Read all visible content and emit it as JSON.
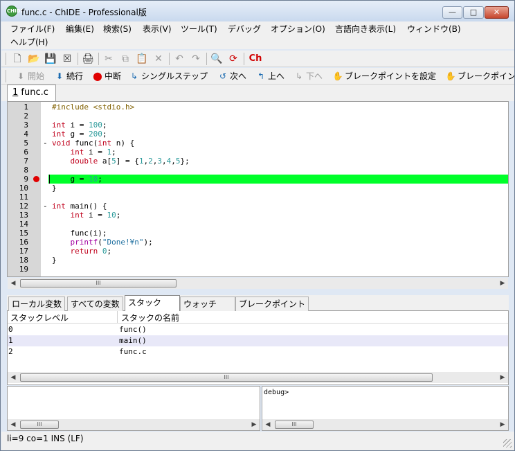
{
  "window": {
    "title": "func.c - ChIDE - Professional版",
    "icon_text": "CHIDE"
  },
  "menu": [
    "ファイル(F)",
    "編集(E)",
    "検索(S)",
    "表示(V)",
    "ツール(T)",
    "デバッグ",
    "オプション(O)",
    "言語向き表示(L)",
    "ウィンドウ(B)",
    "ヘルプ(H)"
  ],
  "toolbar": {
    "icons": [
      "new-file-icon",
      "open-folder-icon",
      "save-icon",
      "close-file-icon",
      "print-icon",
      "cut-icon",
      "copy-icon",
      "paste-icon",
      "delete-icon",
      "undo-icon",
      "redo-icon",
      "find-icon",
      "replace-icon",
      "ch-run-icon"
    ],
    "ch_label": "Ch"
  },
  "debug_toolbar": {
    "start": "開始",
    "continue": "続行",
    "abort": "中断",
    "single_step": "シングルステップ",
    "next": "次へ",
    "up": "上へ",
    "down": "下へ",
    "set_breakpoint": "ブレークポイントを設定",
    "breakpoint_truncated": "ブレークポイン"
  },
  "file_tab": {
    "index": "1",
    "name": "func.c"
  },
  "editor": {
    "breakpoint_line": 9,
    "current_line": 9,
    "highlight_color": "#00ff2a",
    "line_numbers": [
      "1",
      "2",
      "3",
      "4",
      "5",
      "6",
      "7",
      "8",
      "9",
      "10",
      "11",
      "12",
      "13",
      "14",
      "15",
      "16",
      "17",
      "18",
      "19"
    ],
    "fold_markers": {
      "5": "-",
      "12": "-"
    },
    "lines": [
      "#include <stdio.h>",
      "",
      "int i = 100;",
      "int g = 200;",
      "void func(int n) {",
      "    int i = 1;",
      "    double a[5] = {1,2,3,4,5};",
      "",
      "    g = 10;",
      "}",
      "",
      "int main() {",
      "    int i = 10;",
      "",
      "    func(i);",
      "    printf(\"Done!¥n\");",
      "    return 0;",
      "}",
      ""
    ]
  },
  "lower_tabs": [
    "ローカル変数",
    "すべての変数",
    "スタック",
    "ウォッチ",
    "ブレークポイント"
  ],
  "active_lower_tab": "スタック",
  "stack": {
    "columns": [
      "スタックレベル",
      "スタックの名前"
    ],
    "rows": [
      {
        "level": "0",
        "name": "func()"
      },
      {
        "level": "1",
        "name": "main()"
      },
      {
        "level": "2",
        "name": "func.c"
      }
    ],
    "selected_row": 1
  },
  "debug_console": {
    "prompt": "debug>"
  },
  "status": {
    "text": "li=9 co=1 INS (LF)"
  },
  "scroll_thumb_glyph": "III",
  "colors": {
    "keyword": "#c0001c",
    "number": "#2a9a9a",
    "preprocessor": "#806000",
    "builtin_function": "#a000a0",
    "breakpoint": "#e00000"
  }
}
